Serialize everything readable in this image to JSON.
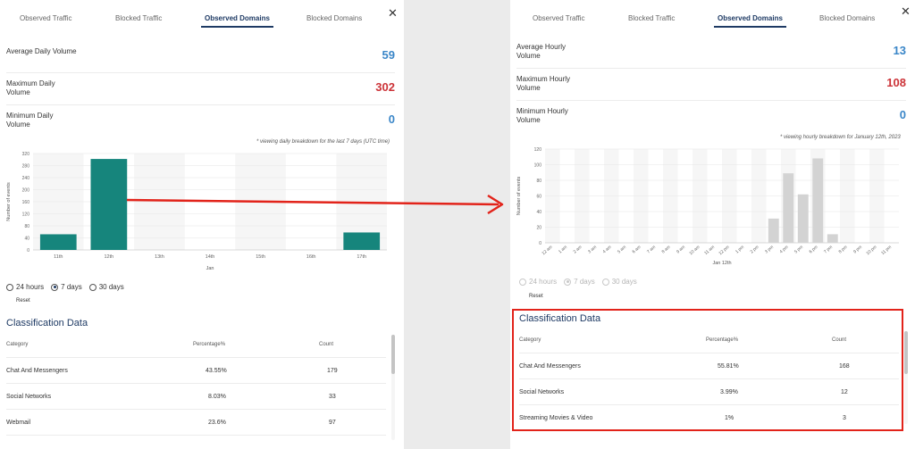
{
  "left": {
    "tabs": [
      "Observed Traffic",
      "Blocked Traffic",
      "Observed Domains",
      "Blocked Domains"
    ],
    "active_tab": 2,
    "close_glyph": "✕",
    "metrics": [
      {
        "label": "Average Daily Volume",
        "value": "59",
        "color": "#3a86c8"
      },
      {
        "label": "Maximum Daily Volume",
        "value": "302",
        "color": "#cc3338"
      },
      {
        "label": "Minimum Daily Volume",
        "value": "0",
        "color": "#3a86c8"
      }
    ],
    "note": "* viewing daily breakdown for the last 7 days (UTC time)",
    "chart_data": {
      "type": "bar",
      "categories": [
        "11th",
        "12th",
        "13th",
        "14th",
        "15th",
        "16th",
        "17th"
      ],
      "values": [
        52,
        302,
        0,
        0,
        0,
        0,
        58
      ],
      "xlabel": "Jan",
      "ylabel": "Number of events",
      "ylim": [
        0,
        320
      ],
      "yticks": [
        0,
        40,
        80,
        120,
        160,
        200,
        240,
        280,
        320
      ],
      "bar_color": "#16857c",
      "grid": true
    },
    "radios": [
      {
        "label": "24 hours",
        "checked": false
      },
      {
        "label": "7 days",
        "checked": true
      },
      {
        "label": "30 days",
        "checked": false
      }
    ],
    "reset_label": "Reset",
    "classification": {
      "title": "Classification Data",
      "headers": [
        "Category",
        "Percentage%",
        "Count"
      ],
      "rows": [
        [
          "Chat And Messengers",
          "43.55%",
          "179"
        ],
        [
          "Social Networks",
          "8.03%",
          "33"
        ],
        [
          "Webmail",
          "23.6%",
          "97"
        ]
      ]
    }
  },
  "right": {
    "tabs": [
      "Observed Traffic",
      "Blocked Traffic",
      "Observed Domains",
      "Blocked Domains"
    ],
    "active_tab": 2,
    "close_glyph": "✕",
    "metrics": [
      {
        "label": "Average Hourly Volume",
        "value": "13",
        "color": "#3a86c8"
      },
      {
        "label": "Maximum Hourly Volume",
        "value": "108",
        "color": "#cc3338"
      },
      {
        "label": "Minimum Hourly Volume",
        "value": "0",
        "color": "#3a86c8"
      }
    ],
    "note": "* viewing hourly breakdown for January 12th, 2023",
    "chart_data": {
      "type": "bar",
      "categories": [
        "12 am",
        "1 am",
        "2 am",
        "3 am",
        "4 am",
        "5 am",
        "6 am",
        "7 am",
        "8 am",
        "9 am",
        "10 am",
        "11 am",
        "12 pm",
        "1 pm",
        "2 pm",
        "3 pm",
        "4 pm",
        "5 pm",
        "6 pm",
        "7 pm",
        "8 pm",
        "9 pm",
        "10 pm",
        "11 pm"
      ],
      "values": [
        0,
        0,
        0,
        0,
        0,
        0,
        0,
        0,
        0,
        0,
        0,
        0,
        0,
        0,
        0,
        31,
        89,
        62,
        108,
        11,
        0,
        0,
        0,
        0
      ],
      "xlabel": "Jan 12th",
      "ylabel": "Number of events",
      "ylim": [
        0,
        120
      ],
      "yticks": [
        0,
        20,
        40,
        60,
        80,
        100,
        120
      ],
      "bar_color": "#d3d3d3",
      "grid": true
    },
    "radios": [
      {
        "label": "24 hours",
        "checked": false
      },
      {
        "label": "7 days",
        "checked": true
      },
      {
        "label": "30 days",
        "checked": false
      }
    ],
    "reset_label": "Reset",
    "classification": {
      "title": "Classification Data",
      "headers": [
        "Category",
        "Percentage%",
        "Count"
      ],
      "rows": [
        [
          "Chat And Messengers",
          "55.81%",
          "168"
        ],
        [
          "Social Networks",
          "3.99%",
          "12"
        ],
        [
          "Streaming Movies & Video",
          "1%",
          "3"
        ]
      ]
    }
  },
  "annotation": {
    "arrow_color": "#e2231a",
    "box_color": "#e2231a"
  }
}
